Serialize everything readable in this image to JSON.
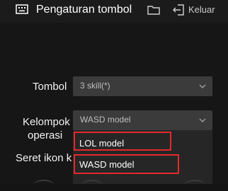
{
  "header": {
    "title": "Pengaturan tombol",
    "exit_label": "Keluar",
    "icons": [
      "keyboard-icon",
      "folder-icon",
      "exit-icon"
    ]
  },
  "form": {
    "tombol": {
      "label": "Tombol",
      "value": "3 skill(*)"
    },
    "kelompok": {
      "label_line1": "Kelompok",
      "label_line2": "operasi",
      "value": "WASD model"
    },
    "drag_label": "Seret ikon k"
  },
  "dropdown": {
    "options": [
      "LOL model",
      "WASD model"
    ]
  },
  "colors": {
    "background": "#141414",
    "select_bg": "#3b3b3b",
    "dropdown_bg": "#262626",
    "highlight_border": "#e2292f"
  }
}
